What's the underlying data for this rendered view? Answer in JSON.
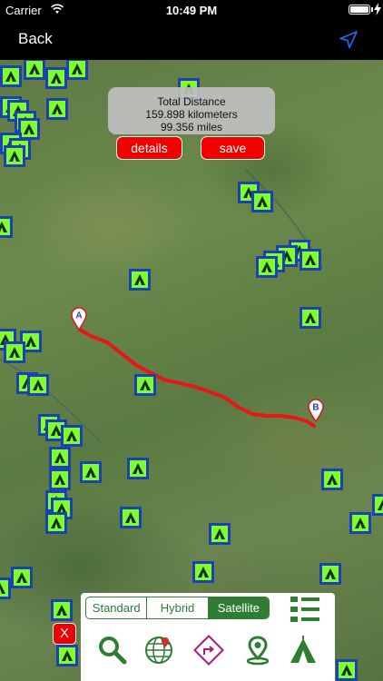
{
  "status_bar": {
    "carrier": "Carrier",
    "time": "10:49 PM"
  },
  "nav": {
    "back_label": "Back"
  },
  "distance": {
    "title": "Total Distance",
    "kilometers": "159.898 kilometers",
    "miles": "99.356 miles"
  },
  "actions": {
    "details_label": "details",
    "save_label": "save"
  },
  "markers": {
    "start_label": "A",
    "end_label": "B"
  },
  "map_type": {
    "options": [
      "Standard",
      "Hybrid",
      "Satellite"
    ],
    "selected": "Satellite"
  },
  "close_label": "X",
  "toolbar_icons": [
    "search-icon",
    "globe-pin-icon",
    "directions-icon",
    "location-pin-icon",
    "tent-icon"
  ],
  "colors": {
    "route": "#e81616",
    "campsite_badge_border": "#1f3fb5",
    "campsite_badge_fill": "#7dff2a",
    "accent_green": "#2e7d32",
    "action_red": "#f20000",
    "location_blue": "#1e6ff2"
  }
}
